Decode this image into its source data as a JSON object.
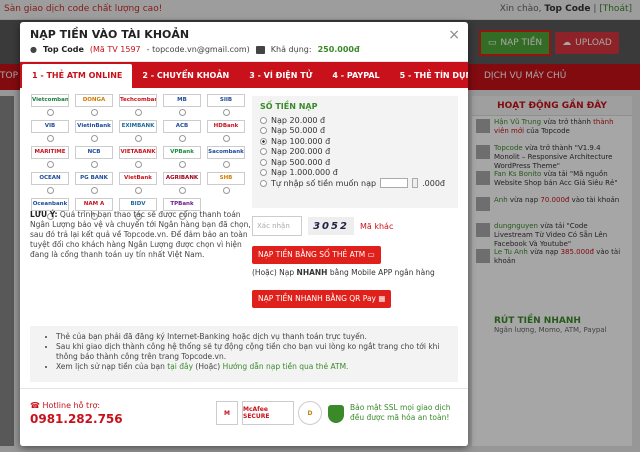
{
  "topbar": {
    "tagline": "Sàn giao dịch code chất lượng cao!",
    "greeting": "Xin chào,",
    "username": "Top Code",
    "logout": "[Thoát]"
  },
  "header": {
    "nap_tien": "NẠP TIỀN",
    "upload": "UPLOAD"
  },
  "navbar": {
    "left": "TOP C",
    "right": "DỊCH VỤ MÁY CHỦ"
  },
  "sidebar": {
    "title": "HOẠT ĐỘNG GẦN ĐÂY",
    "items": [
      {
        "user": "Hận Vũ Trung",
        "text": "vừa trở thành",
        "highlight": "thành viên mới",
        "rest": "của Topcode"
      },
      {
        "user": "Topcode",
        "text": "vừa trở thành",
        "highlight": "",
        "rest": "\"V1.9.4 Monolit – Responsive Architecture WordPress Theme\""
      },
      {
        "user": "Fan Ks Bonito",
        "text": "vừa tải",
        "highlight": "",
        "rest": "\"Mã nguồn Website Shop bán Acc Giá Siêu Rẻ\""
      },
      {
        "user": "Anh",
        "text": "vừa nạp",
        "highlight": "70.000đ",
        "rest": "vào tài khoản"
      },
      {
        "user": "dungnguyen",
        "text": "vừa tải",
        "highlight": "",
        "rest": "\"Code Livestream Từ Video Có Sẵn Lên Facebook Và Youtube\""
      },
      {
        "user": "Le Tu Anh",
        "text": "vừa nạp",
        "highlight": "385.000đ",
        "rest": "vào tài khoản"
      }
    ]
  },
  "rut_tien": {
    "title": "RÚT TIỀN NHANH",
    "sub": "Ngân lượng, Momo, ATM, Paypal"
  },
  "modal": {
    "title": "NẠP TIỀN VÀO TÀI KHOẢN",
    "close": "×",
    "user_name": "Top Code",
    "member_code": "(Mã TV 1597",
    "email": "- topcode.vn@gmail.com)",
    "balance_label": "Khả dụng:",
    "balance": "250.000đ",
    "tabs": [
      "1 - THẺ ATM ONLINE",
      "2 - CHUYỂN KHOẢN",
      "3 - VÍ ĐIỆN TỬ",
      "4 - PAYPAL",
      "5 - THẺ TÍN DỤNG"
    ],
    "banks": [
      "Vietcombank",
      "DONGA",
      "Techcombank",
      "MB",
      "SIIB",
      "VIB",
      "VietinBank",
      "EXIMBANK",
      "ACB",
      "HDBank",
      "MARITIME",
      "NCB",
      "VIETABANK",
      "VPBank",
      "Sacombank",
      "OCEAN",
      "PG BANK",
      "VietBank",
      "AGRIBANK",
      "SHB",
      "Oceanbank",
      "NAM A",
      "BIDV",
      "TPBank",
      ""
    ],
    "note_label": "LƯU Ý:",
    "note": "Quá trình bạn thao tác sẽ được cổng thanh toán Ngân Lượng bảo vệ và chuyển tới Ngân hàng bạn đã chọn, sau đó trả lại kết quả về Topcode.vn. Để đảm bảo an toàn tuyệt đối cho khách hàng Ngân Lượng được chọn vì hiện đang là cổng thanh toán uy tín nhất Việt Nam.",
    "amount_title": "SỐ TIỀN NẠP",
    "amounts": [
      "Nạp 20.000 đ",
      "Nạp 50.000 đ",
      "Nạp 100.000 đ",
      "Nạp 200.000 đ",
      "Nạp 500.000 đ",
      "Nạp 1.000.000 đ"
    ],
    "selected_amount": 2,
    "custom_label": "Tự nhập số tiền muốn nạp",
    "custom_suffix": ".000đ",
    "captcha_placeholder": "Xác nhận",
    "captcha_text": "3052",
    "captcha_other": "Mã khác",
    "btn_atm": "NẠP TIỀN BẰNG SỐ THẺ ATM",
    "or_text_1": "(Hoặc) Nạp",
    "or_text_bold": "NHANH",
    "or_text_2": "bằng Mobile APP ngân hàng",
    "btn_qr": "NẠP TIỀN NHANH BẰNG QR Pay",
    "info": [
      "Thẻ của bạn phải đã đăng ký Internet-Banking hoặc dịch vụ thanh toán trực tuyến.",
      "Sau khi giao dịch thành công hệ thống sẽ tự động cộng tiền cho bạn vui lòng ko ngắt trang cho tới khi thông báo thành công trên trang Topcode.vn."
    ],
    "info_last_1": "Xem lịch sử nạp tiền của bạn",
    "info_last_link": "tại đây",
    "info_last_2": "(Hoặc)",
    "info_last_link2": "Hướng dẫn nạp tiền qua thẻ ATM.",
    "hotline_label": "Hotline hỗ trợ:",
    "hotline": "0981.282.756",
    "seal_mcafee": "McAfee SECURE",
    "ssl_text": "Bảo mật SSL mọi giao dịch đều được mã hóa an toàn!"
  }
}
